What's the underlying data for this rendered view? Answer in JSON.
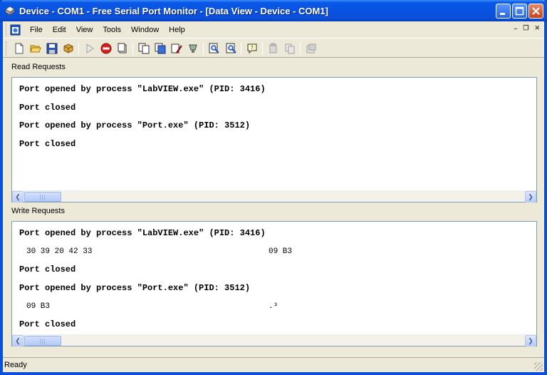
{
  "window": {
    "title": "Device - COM1 - Free Serial Port Monitor - [Data View - Device - COM1]"
  },
  "menu": {
    "items": [
      "File",
      "Edit",
      "View",
      "Tools",
      "Window",
      "Help"
    ]
  },
  "toolbar": {
    "buttons": [
      "new-icon",
      "open-icon",
      "save-icon",
      "package-icon",
      "play-icon",
      "stop-icon",
      "clear-icon",
      "copy-icon",
      "data-view-icon",
      "edit-icon",
      "filter-icon",
      "find-icon",
      "find-next-icon",
      "comment-icon",
      "paste-disabled-icon",
      "copy-disabled-icon",
      "export-disabled-icon"
    ]
  },
  "read_panel": {
    "label": "Read Requests",
    "lines": [
      "Port opened by process \"LabVIEW.exe\" (PID: 3416)",
      "Port closed",
      "Port opened by process \"Port.exe\" (PID: 3512)",
      "Port closed"
    ]
  },
  "write_panel": {
    "label": "Write Requests",
    "line1": "Port opened by process \"LabVIEW.exe\" (PID: 3416)",
    "hex1_bytes": "30 39 20 42 33",
    "hex1_ascii": "09 B3",
    "line2": "Port closed",
    "line3": "Port opened by process \"Port.exe\" (PID: 3512)",
    "hex2_bytes": "09 B3",
    "hex2_ascii": ".³",
    "line4": "Port closed"
  },
  "status": {
    "text": "Ready"
  },
  "colors": {
    "title_bar": "#0a4fd8",
    "chrome": "#ece9d8",
    "panel_border": "#7f9db9"
  }
}
